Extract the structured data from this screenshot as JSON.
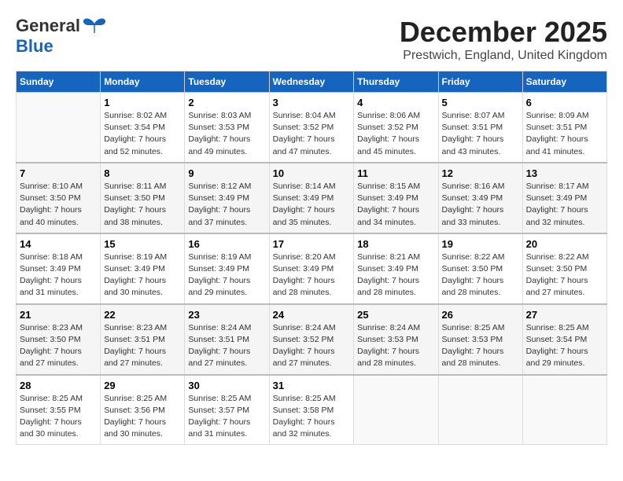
{
  "logo": {
    "line1": "General",
    "line2": "Blue"
  },
  "title": "December 2025",
  "subtitle": "Prestwich, England, United Kingdom",
  "weekdays": [
    "Sunday",
    "Monday",
    "Tuesday",
    "Wednesday",
    "Thursday",
    "Friday",
    "Saturday"
  ],
  "weeks": [
    [
      {
        "day": "",
        "info": ""
      },
      {
        "day": "1",
        "info": "Sunrise: 8:02 AM\nSunset: 3:54 PM\nDaylight: 7 hours\nand 52 minutes."
      },
      {
        "day": "2",
        "info": "Sunrise: 8:03 AM\nSunset: 3:53 PM\nDaylight: 7 hours\nand 49 minutes."
      },
      {
        "day": "3",
        "info": "Sunrise: 8:04 AM\nSunset: 3:52 PM\nDaylight: 7 hours\nand 47 minutes."
      },
      {
        "day": "4",
        "info": "Sunrise: 8:06 AM\nSunset: 3:52 PM\nDaylight: 7 hours\nand 45 minutes."
      },
      {
        "day": "5",
        "info": "Sunrise: 8:07 AM\nSunset: 3:51 PM\nDaylight: 7 hours\nand 43 minutes."
      },
      {
        "day": "6",
        "info": "Sunrise: 8:09 AM\nSunset: 3:51 PM\nDaylight: 7 hours\nand 41 minutes."
      }
    ],
    [
      {
        "day": "7",
        "info": "Sunrise: 8:10 AM\nSunset: 3:50 PM\nDaylight: 7 hours\nand 40 minutes."
      },
      {
        "day": "8",
        "info": "Sunrise: 8:11 AM\nSunset: 3:50 PM\nDaylight: 7 hours\nand 38 minutes."
      },
      {
        "day": "9",
        "info": "Sunrise: 8:12 AM\nSunset: 3:49 PM\nDaylight: 7 hours\nand 37 minutes."
      },
      {
        "day": "10",
        "info": "Sunrise: 8:14 AM\nSunset: 3:49 PM\nDaylight: 7 hours\nand 35 minutes."
      },
      {
        "day": "11",
        "info": "Sunrise: 8:15 AM\nSunset: 3:49 PM\nDaylight: 7 hours\nand 34 minutes."
      },
      {
        "day": "12",
        "info": "Sunrise: 8:16 AM\nSunset: 3:49 PM\nDaylight: 7 hours\nand 33 minutes."
      },
      {
        "day": "13",
        "info": "Sunrise: 8:17 AM\nSunset: 3:49 PM\nDaylight: 7 hours\nand 32 minutes."
      }
    ],
    [
      {
        "day": "14",
        "info": "Sunrise: 8:18 AM\nSunset: 3:49 PM\nDaylight: 7 hours\nand 31 minutes."
      },
      {
        "day": "15",
        "info": "Sunrise: 8:19 AM\nSunset: 3:49 PM\nDaylight: 7 hours\nand 30 minutes."
      },
      {
        "day": "16",
        "info": "Sunrise: 8:19 AM\nSunset: 3:49 PM\nDaylight: 7 hours\nand 29 minutes."
      },
      {
        "day": "17",
        "info": "Sunrise: 8:20 AM\nSunset: 3:49 PM\nDaylight: 7 hours\nand 28 minutes."
      },
      {
        "day": "18",
        "info": "Sunrise: 8:21 AM\nSunset: 3:49 PM\nDaylight: 7 hours\nand 28 minutes."
      },
      {
        "day": "19",
        "info": "Sunrise: 8:22 AM\nSunset: 3:50 PM\nDaylight: 7 hours\nand 28 minutes."
      },
      {
        "day": "20",
        "info": "Sunrise: 8:22 AM\nSunset: 3:50 PM\nDaylight: 7 hours\nand 27 minutes."
      }
    ],
    [
      {
        "day": "21",
        "info": "Sunrise: 8:23 AM\nSunset: 3:50 PM\nDaylight: 7 hours\nand 27 minutes."
      },
      {
        "day": "22",
        "info": "Sunrise: 8:23 AM\nSunset: 3:51 PM\nDaylight: 7 hours\nand 27 minutes."
      },
      {
        "day": "23",
        "info": "Sunrise: 8:24 AM\nSunset: 3:51 PM\nDaylight: 7 hours\nand 27 minutes."
      },
      {
        "day": "24",
        "info": "Sunrise: 8:24 AM\nSunset: 3:52 PM\nDaylight: 7 hours\nand 27 minutes."
      },
      {
        "day": "25",
        "info": "Sunrise: 8:24 AM\nSunset: 3:53 PM\nDaylight: 7 hours\nand 28 minutes."
      },
      {
        "day": "26",
        "info": "Sunrise: 8:25 AM\nSunset: 3:53 PM\nDaylight: 7 hours\nand 28 minutes."
      },
      {
        "day": "27",
        "info": "Sunrise: 8:25 AM\nSunset: 3:54 PM\nDaylight: 7 hours\nand 29 minutes."
      }
    ],
    [
      {
        "day": "28",
        "info": "Sunrise: 8:25 AM\nSunset: 3:55 PM\nDaylight: 7 hours\nand 30 minutes."
      },
      {
        "day": "29",
        "info": "Sunrise: 8:25 AM\nSunset: 3:56 PM\nDaylight: 7 hours\nand 30 minutes."
      },
      {
        "day": "30",
        "info": "Sunrise: 8:25 AM\nSunset: 3:57 PM\nDaylight: 7 hours\nand 31 minutes."
      },
      {
        "day": "31",
        "info": "Sunrise: 8:25 AM\nSunset: 3:58 PM\nDaylight: 7 hours\nand 32 minutes."
      },
      {
        "day": "",
        "info": ""
      },
      {
        "day": "",
        "info": ""
      },
      {
        "day": "",
        "info": ""
      }
    ]
  ]
}
